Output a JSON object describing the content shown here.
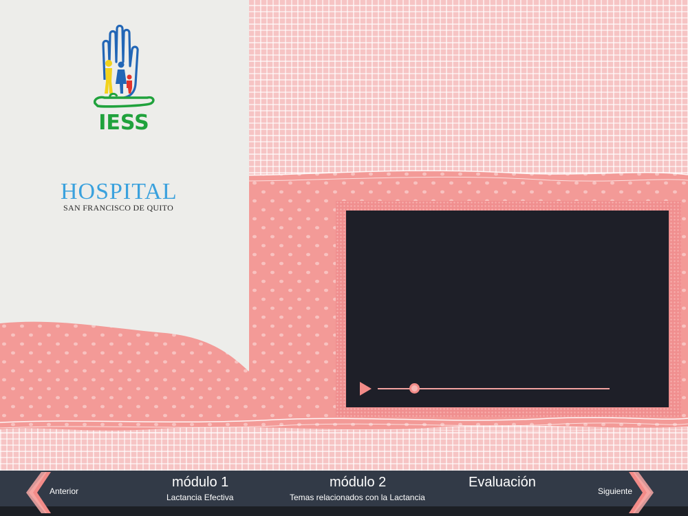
{
  "logo": {
    "brand_text": "IESS",
    "icon": "iess-hand-family-logo"
  },
  "hospital": {
    "title": "HOSPITAL",
    "subtitle": "SAN FRANCISCO DE QUITO"
  },
  "video": {
    "play_icon": "play-icon",
    "progress_fraction": 0.16
  },
  "nav": {
    "prev_label": "Anterior",
    "next_label": "Siguiente",
    "prev_icon": "chevron-left-icon",
    "next_icon": "chevron-right-icon",
    "items": [
      {
        "title": "módulo 1",
        "subtitle": "Lactancia Efectiva"
      },
      {
        "title": "módulo 2",
        "subtitle": "Temas relacionados con la Lactancia"
      },
      {
        "title": "Evaluación",
        "subtitle": ""
      }
    ]
  },
  "colors": {
    "panel": "#ededea",
    "salmon": "#f39a97",
    "accent": "#f28b88",
    "video_bg": "#1e1f28",
    "nav_bg": "#323a47",
    "hospital_blue": "#3aa1dd",
    "iess_green": "#20a23c"
  }
}
